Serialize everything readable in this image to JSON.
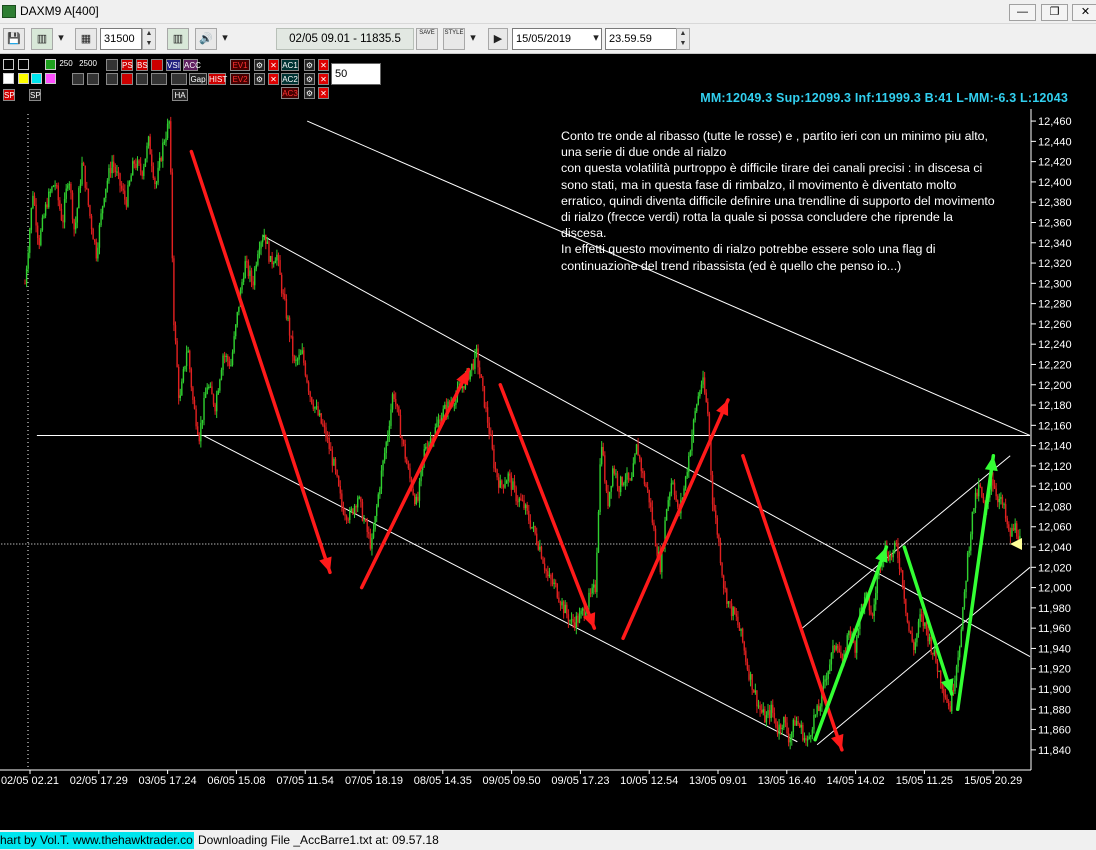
{
  "window": {
    "title": "DAXM9 A[400]",
    "buttons": {
      "minimize": "—",
      "restore": "❐",
      "close": "✕"
    }
  },
  "toolbar": {
    "bar_count": "31500",
    "cursor_readout": "02/05 09.01 - 11835.5",
    "date_value": "15/05/2019",
    "time_value": "23.59.59",
    "save_label": "SAVE",
    "style_label": "STYLE"
  },
  "indicator_toolbar": {
    "ma_values": [
      "250",
      "2500"
    ],
    "labels": [
      "PS",
      "BS",
      "VSI",
      "ACC",
      "Gap",
      "HIST",
      "HA",
      "EV1",
      "EV2",
      "AC1",
      "AC2",
      "AC3",
      "SP",
      "SP"
    ],
    "period_input": "50"
  },
  "stats_line": "MM:12049.3 Sup:12099.3 Inf:11999.3 B:41 L-MM:-6.3 L:12043",
  "annotation": [
    "Conto tre onde al ribasso (tutte le rosse) e , partito ieri con un minimo piu alto,",
    "una serie di due onde al rialzo",
    "con questa volatilità purtroppo è difficile tirare dei canali precisi  : in discesa ci",
    "sono stati, ma in questa fase di rimbalzo, il movimento è diventato molto",
    "erratico, quindi diventa difficile definire una trendline di supporto del movimento",
    "di rialzo (frecce verdi) rotta la quale si possa concludere che riprende la",
    "discesa.",
    "In effetti questo movimento di rialzo potrebbe essere solo una flag di",
    "continuazione del trend ribassista (ed è quello che penso io...)"
  ],
  "colors": {
    "background": "#000000",
    "up_candle": "#30d030",
    "down_candle": "#e02020",
    "red_arrow": "#ff1a1a",
    "green_arrow": "#33ff33",
    "stats": "#32d0f0",
    "lines": "#ffffff"
  },
  "status": {
    "link": "hart by Vol.T. www.thehawktrader.co",
    "text": "Downloading File _AccBarre1.txt at: 09.57.18"
  },
  "chart_data": {
    "type": "candlestick",
    "symbol": "DAXM9",
    "y_axis": {
      "ylim": [
        11830,
        12465
      ],
      "ticks": [
        "12,460",
        "12,440",
        "12,420",
        "12,400",
        "12,380",
        "12,360",
        "12,340",
        "12,320",
        "12,300",
        "12,280",
        "12,260",
        "12,240",
        "12,220",
        "12,200",
        "12,180",
        "12,160",
        "12,140",
        "12,120",
        "12,100",
        "12,080",
        "12,060",
        "12,040",
        "12,020",
        "12,000",
        "11,980",
        "11,960",
        "11,940",
        "11,920",
        "11,900",
        "11,880",
        "11,860",
        "11,840"
      ]
    },
    "x_axis": {
      "ticks": [
        "02/05 02.21",
        "02/05 17.29",
        "03/05 17.24",
        "06/05 15.08",
        "07/05 11.54",
        "07/05 18.19",
        "08/05 14.35",
        "09/05 09.50",
        "09/05 17.23",
        "10/05 12.54",
        "13/05 09.01",
        "13/05 16.40",
        "14/05 14.02",
        "15/05 11.25",
        "15/05 20.29"
      ]
    },
    "price_path": [
      [
        0,
        12300
      ],
      [
        8,
        12390
      ],
      [
        14,
        12340
      ],
      [
        22,
        12380
      ],
      [
        30,
        12400
      ],
      [
        38,
        12360
      ],
      [
        44,
        12410
      ],
      [
        50,
        12350
      ],
      [
        58,
        12420
      ],
      [
        65,
        12370
      ],
      [
        72,
        12330
      ],
      [
        80,
        12390
      ],
      [
        88,
        12420
      ],
      [
        95,
        12400
      ],
      [
        102,
        12380
      ],
      [
        110,
        12420
      ],
      [
        118,
        12410
      ],
      [
        125,
        12440
      ],
      [
        132,
        12395
      ],
      [
        140,
        12440
      ],
      [
        146,
        12460
      ],
      [
        150,
        12270
      ],
      [
        156,
        12180
      ],
      [
        164,
        12240
      ],
      [
        170,
        12180
      ],
      [
        176,
        12150
      ],
      [
        184,
        12200
      ],
      [
        192,
        12180
      ],
      [
        200,
        12230
      ],
      [
        208,
        12220
      ],
      [
        216,
        12280
      ],
      [
        222,
        12320
      ],
      [
        230,
        12300
      ],
      [
        236,
        12340
      ],
      [
        242,
        12350
      ],
      [
        248,
        12320
      ],
      [
        254,
        12330
      ],
      [
        260,
        12290
      ],
      [
        266,
        12260
      ],
      [
        272,
        12220
      ],
      [
        280,
        12230
      ],
      [
        288,
        12190
      ],
      [
        296,
        12170
      ],
      [
        304,
        12150
      ],
      [
        312,
        12120
      ],
      [
        320,
        12080
      ],
      [
        328,
        12070
      ],
      [
        336,
        12090
      ],
      [
        344,
        12060
      ],
      [
        350,
        12040
      ],
      [
        358,
        12100
      ],
      [
        366,
        12150
      ],
      [
        372,
        12195
      ],
      [
        380,
        12150
      ],
      [
        388,
        12110
      ],
      [
        396,
        12080
      ],
      [
        404,
        12140
      ],
      [
        412,
        12150
      ],
      [
        420,
        12170
      ],
      [
        428,
        12180
      ],
      [
        436,
        12190
      ],
      [
        442,
        12200
      ],
      [
        450,
        12215
      ],
      [
        456,
        12230
      ],
      [
        462,
        12195
      ],
      [
        468,
        12160
      ],
      [
        474,
        12120
      ],
      [
        480,
        12100
      ],
      [
        488,
        12110
      ],
      [
        496,
        12090
      ],
      [
        504,
        12080
      ],
      [
        512,
        12060
      ],
      [
        520,
        12040
      ],
      [
        528,
        12010
      ],
      [
        536,
        12000
      ],
      [
        544,
        11980
      ],
      [
        552,
        11965
      ],
      [
        560,
        11970
      ],
      [
        568,
        11985
      ],
      [
        576,
        12000
      ],
      [
        582,
        12150
      ],
      [
        588,
        12080
      ],
      [
        594,
        12120
      ],
      [
        600,
        12100
      ],
      [
        606,
        12110
      ],
      [
        612,
        12100
      ],
      [
        618,
        12140
      ],
      [
        624,
        12110
      ],
      [
        630,
        12090
      ],
      [
        636,
        12050
      ],
      [
        642,
        12020
      ],
      [
        648,
        12080
      ],
      [
        654,
        12110
      ],
      [
        660,
        12070
      ],
      [
        666,
        12100
      ],
      [
        672,
        12140
      ],
      [
        678,
        12180
      ],
      [
        684,
        12205
      ],
      [
        690,
        12170
      ],
      [
        694,
        12090
      ],
      [
        700,
        12050
      ],
      [
        706,
        12000
      ],
      [
        712,
        11980
      ],
      [
        718,
        11970
      ],
      [
        724,
        11950
      ],
      [
        730,
        11920
      ],
      [
        736,
        11900
      ],
      [
        742,
        11880
      ],
      [
        748,
        11870
      ],
      [
        754,
        11880
      ],
      [
        760,
        11860
      ],
      [
        766,
        11870
      ],
      [
        772,
        11850
      ],
      [
        778,
        11870
      ],
      [
        784,
        11860
      ],
      [
        790,
        11845
      ],
      [
        796,
        11870
      ],
      [
        802,
        11880
      ],
      [
        808,
        11910
      ],
      [
        814,
        11930
      ],
      [
        820,
        11950
      ],
      [
        826,
        11920
      ],
      [
        832,
        11960
      ],
      [
        838,
        11940
      ],
      [
        844,
        11980
      ],
      [
        850,
        11990
      ],
      [
        856,
        11970
      ],
      [
        862,
        12020
      ],
      [
        868,
        12040
      ],
      [
        874,
        12030
      ],
      [
        880,
        12040
      ],
      [
        886,
        12010
      ],
      [
        892,
        11960
      ],
      [
        898,
        11940
      ],
      [
        904,
        11970
      ],
      [
        910,
        11960
      ],
      [
        916,
        11940
      ],
      [
        922,
        11920
      ],
      [
        928,
        11900
      ],
      [
        934,
        11880
      ],
      [
        940,
        11920
      ],
      [
        946,
        11960
      ],
      [
        952,
        12030
      ],
      [
        958,
        12080
      ],
      [
        964,
        12100
      ],
      [
        970,
        12070
      ],
      [
        976,
        12110
      ],
      [
        982,
        12090
      ],
      [
        988,
        12080
      ],
      [
        994,
        12050
      ],
      [
        1000,
        12060
      ],
      [
        1006,
        12043
      ]
    ],
    "horizontal_lines": [
      {
        "y": 12150,
        "style": "solid",
        "x_range": [
          12,
          1015
        ]
      },
      {
        "y": 12043,
        "style": "dotted",
        "x_range": [
          -30,
          1015
        ]
      }
    ],
    "channel_lines": [
      {
        "from": [
          285,
          12460
        ],
        "to": [
          1015,
          12150
        ]
      },
      {
        "from": [
          240,
          12347
        ],
        "to": [
          1015,
          11932
        ]
      },
      {
        "from": [
          180,
          12150
        ],
        "to": [
          780,
          11848
        ]
      },
      {
        "from": [
          785,
          11960
        ],
        "to": [
          995,
          12130
        ]
      },
      {
        "from": [
          800,
          11845
        ],
        "to": [
          1015,
          12020
        ]
      }
    ],
    "arrows_red": [
      {
        "from": [
          168,
          12430
        ],
        "to": [
          308,
          12015
        ]
      },
      {
        "from": [
          340,
          12000
        ],
        "to": [
          448,
          12215
        ]
      },
      {
        "from": [
          480,
          12200
        ],
        "to": [
          575,
          11960
        ]
      },
      {
        "from": [
          604,
          11950
        ],
        "to": [
          710,
          12185
        ]
      },
      {
        "from": [
          725,
          12130
        ],
        "to": [
          825,
          11840
        ]
      }
    ],
    "arrows_green": [
      {
        "from": [
          798,
          11850
        ],
        "to": [
          870,
          12040
        ]
      },
      {
        "from": [
          888,
          12040
        ],
        "to": [
          936,
          11895
        ]
      },
      {
        "from": [
          942,
          11880
        ],
        "to": [
          978,
          12130
        ]
      }
    ],
    "current_price": 12043
  }
}
